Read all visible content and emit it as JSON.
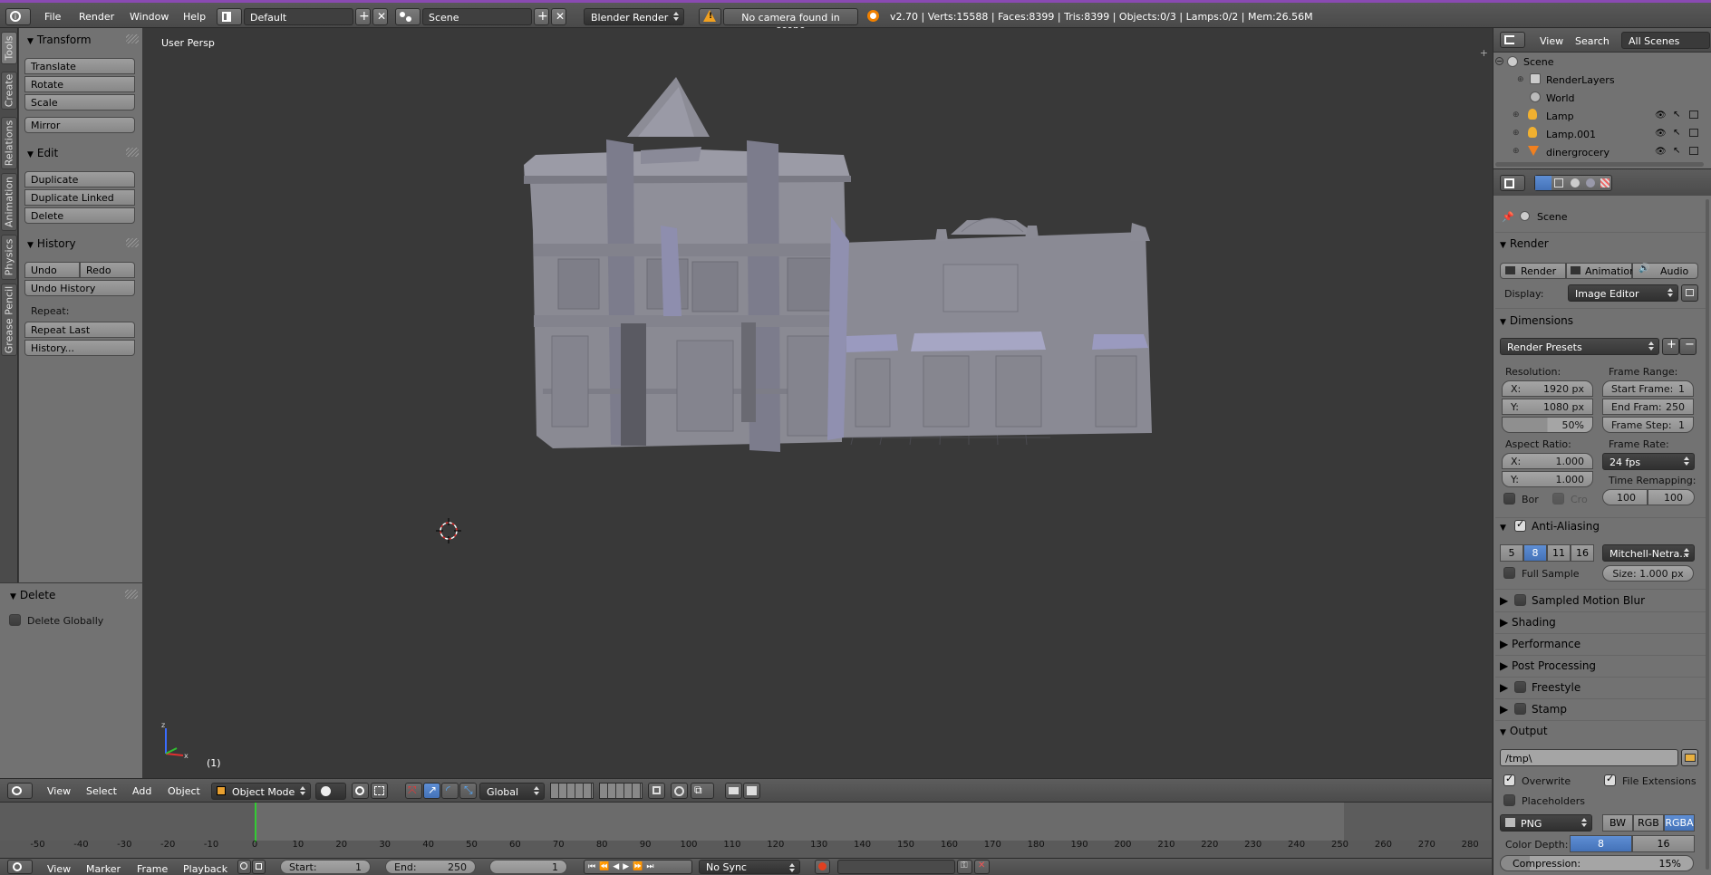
{
  "topbar": {
    "menus": [
      "File",
      "Render",
      "Window",
      "Help"
    ],
    "screen_layout": "Default",
    "scene": "Scene",
    "render_engine": "Blender Render",
    "warning": "No camera found in scene",
    "stats": "v2.70 | Verts:15588 | Faces:8399 | Tris:8399 | Objects:0/3 | Lamps:0/2 | Mem:26.56M"
  },
  "left_tabs": [
    "Tools",
    "Create",
    "Relations",
    "Animation",
    "Physics",
    "Grease Pencil"
  ],
  "tools": {
    "transform_title": "Transform",
    "translate": "Translate",
    "rotate": "Rotate",
    "scale": "Scale",
    "mirror": "Mirror",
    "edit_title": "Edit",
    "duplicate": "Duplicate",
    "duplicate_linked": "Duplicate Linked",
    "delete": "Delete",
    "history_title": "History",
    "undo": "Undo",
    "redo": "Redo",
    "undo_history": "Undo History",
    "repeat_label": "Repeat:",
    "repeat_last": "Repeat Last",
    "history_ellipsis": "History..."
  },
  "operator": {
    "title": "Delete",
    "delete_globally": "Delete Globally",
    "delete_globally_checked": false
  },
  "viewport": {
    "label": "User Persp",
    "frame_indicator": "(1)"
  },
  "view3d_header": {
    "menus": [
      "View",
      "Select",
      "Add",
      "Object"
    ],
    "mode": "Object Mode",
    "orientation": "Global"
  },
  "timeline": {
    "ticks": [
      "-50",
      "-40",
      "-30",
      "-20",
      "-10",
      "0",
      "10",
      "20",
      "30",
      "40",
      "50",
      "60",
      "70",
      "80",
      "90",
      "100",
      "110",
      "120",
      "130",
      "140",
      "150",
      "160",
      "170",
      "180",
      "190",
      "200",
      "210",
      "220",
      "230",
      "240",
      "250",
      "260",
      "270",
      "280"
    ],
    "menus": [
      "View",
      "Marker",
      "Frame",
      "Playback"
    ],
    "start_label": "Start:",
    "start_value": "1",
    "end_label": "End:",
    "end_value": "250",
    "current_value": "1",
    "sync": "No Sync"
  },
  "outliner": {
    "menus": [
      "View",
      "Search"
    ],
    "filter": "All Scenes",
    "items": [
      "Scene",
      "RenderLayers",
      "World",
      "Lamp",
      "Lamp.001",
      "dinergrocery"
    ]
  },
  "properties": {
    "breadcrumb": "Scene",
    "render_title": "Render",
    "render_btn": "Render",
    "animation_btn": "Animation",
    "audio_btn": "Audio",
    "display_label": "Display:",
    "display_value": "Image Editor",
    "dimensions_title": "Dimensions",
    "render_presets": "Render Presets",
    "resolution_label": "Resolution:",
    "res_x_label": "X:",
    "res_x_value": "1920 px",
    "res_y_label": "Y:",
    "res_y_value": "1080 px",
    "res_pct": "50%",
    "frame_range_label": "Frame Range:",
    "start_frame_label": "Start Frame:",
    "start_frame_value": "1",
    "end_frame_label": "End Fram:",
    "end_frame_value": "250",
    "frame_step_label": "Frame Step:",
    "frame_step_value": "1",
    "aspect_label": "Aspect Ratio:",
    "aspect_x_label": "X:",
    "aspect_x_value": "1.000",
    "aspect_y_label": "Y:",
    "aspect_y_value": "1.000",
    "frame_rate_label": "Frame Rate:",
    "frame_rate_value": "24 fps",
    "time_remap_label": "Time Remapping:",
    "time_remap_old": "100",
    "time_remap_new": "100",
    "border_label": "Bor",
    "crop_label": "Cro",
    "aa_title": "Anti-Aliasing",
    "aa_samples": [
      "5",
      "8",
      "11",
      "16"
    ],
    "aa_selected": "8",
    "aa_filter": "Mitchell-Netra...",
    "full_sample": "Full Sample",
    "aa_size": "Size: 1.000 px",
    "motion_blur": "Sampled Motion Blur",
    "shading": "Shading",
    "performance": "Performance",
    "post_processing": "Post Processing",
    "freestyle": "Freestyle",
    "stamp": "Stamp",
    "output_title": "Output",
    "output_path": "/tmp\\",
    "overwrite": "Overwrite",
    "file_extensions": "File Extensions",
    "placeholders": "Placeholders",
    "file_format": "PNG",
    "color_modes": [
      "BW",
      "RGB",
      "RGBA"
    ],
    "color_mode_selected": "RGBA",
    "color_depth_label": "Color Depth:",
    "color_depth_options": [
      "8",
      "16"
    ],
    "color_depth_selected": "8",
    "compression_label": "Compression:",
    "compression_value": "15%"
  },
  "colors": {
    "accent_blue": "#5680c2",
    "title_strip": "#8a4ab2",
    "viewport_bg": "#393939",
    "panel_bg": "#727272",
    "playhead": "#33cc33",
    "model_gray": "#8d8d97"
  }
}
